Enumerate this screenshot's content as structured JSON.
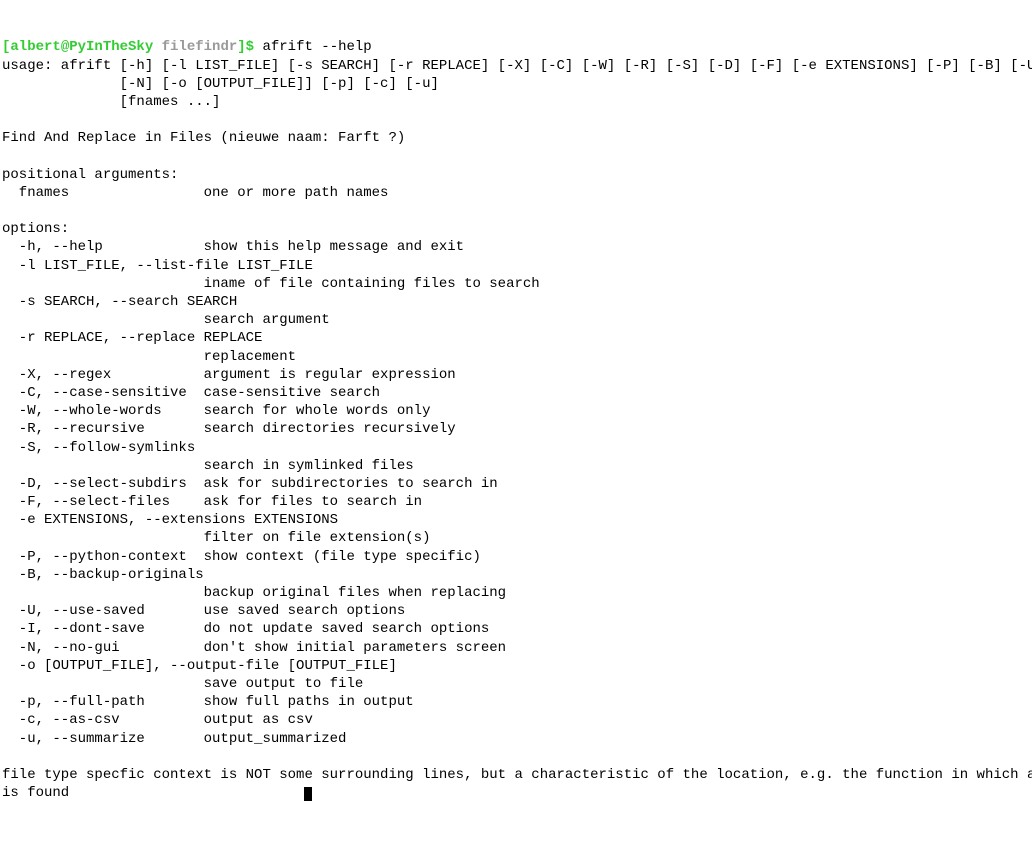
{
  "prompt": {
    "open_bracket": "[",
    "userhost": "albert@PyInTheSky",
    "space": " ",
    "path": "filefindr",
    "close_bracket": "]",
    "dollar": "$",
    "command": " afrift --help"
  },
  "usage": {
    "line1": "usage: afrift [-h] [-l LIST_FILE] [-s SEARCH] [-r REPLACE] [-X] [-C] [-W] [-R] [-S] [-D] [-F] [-e EXTENSIONS] [-P] [-B] [-U] [-I]",
    "line2": "              [-N] [-o [OUTPUT_FILE]] [-p] [-c] [-u]",
    "line3": "              [fnames ...]"
  },
  "description": "Find And Replace in Files (nieuwe naam: Farft ?)",
  "positional_header": "positional arguments:",
  "positional": {
    "fnames": "  fnames                one or more path names"
  },
  "options_header": "options:",
  "options": {
    "help": "  -h, --help            show this help message and exit",
    "list_file": "  -l LIST_FILE, --list-file LIST_FILE",
    "list_file_desc": "                        iname of file containing files to search",
    "search": "  -s SEARCH, --search SEARCH",
    "search_desc": "                        search argument",
    "replace": "  -r REPLACE, --replace REPLACE",
    "replace_desc": "                        replacement",
    "regex": "  -X, --regex           argument is regular expression",
    "case": "  -C, --case-sensitive  case-sensitive search",
    "whole": "  -W, --whole-words     search for whole words only",
    "recursive": "  -R, --recursive       search directories recursively",
    "symlinks": "  -S, --follow-symlinks",
    "symlinks_desc": "                        search in symlinked files",
    "subdirs": "  -D, --select-subdirs  ask for subdirectories to search in",
    "files": "  -F, --select-files    ask for files to search in",
    "ext": "  -e EXTENSIONS, --extensions EXTENSIONS",
    "ext_desc": "                        filter on file extension(s)",
    "python": "  -P, --python-context  show context (file type specific)",
    "backup": "  -B, --backup-originals",
    "backup_desc": "                        backup original files when replacing",
    "use_saved": "  -U, --use-saved       use saved search options",
    "dont_save": "  -I, --dont-save       do not update saved search options",
    "nogui": "  -N, --no-gui          don't show initial parameters screen",
    "output": "  -o [OUTPUT_FILE], --output-file [OUTPUT_FILE]",
    "output_desc": "                        save output to file",
    "fullpath": "  -p, --full-path       show full paths in output",
    "csv": "  -c, --as-csv          output as csv",
    "summarize": "  -u, --summarize       output_summarized"
  },
  "footer": {
    "line1": "file type specfic context is NOT some surrounding lines, but a characteristic of the location, e.g. the function in which a line",
    "line2": "is found"
  }
}
